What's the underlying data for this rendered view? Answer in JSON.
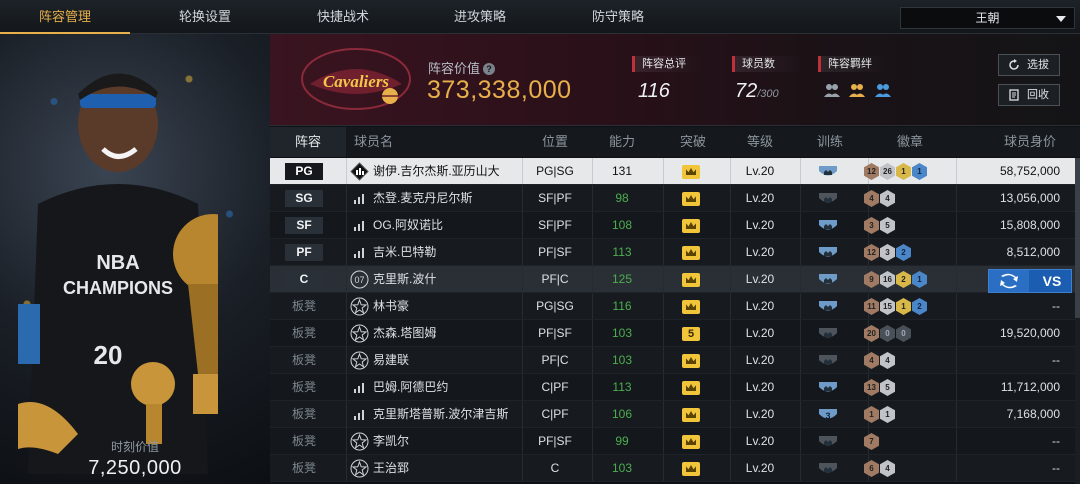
{
  "nav": {
    "tabs": [
      {
        "label": "阵容管理",
        "active": true
      },
      {
        "label": "轮换设置",
        "active": false
      },
      {
        "label": "快捷战术",
        "active": false
      },
      {
        "label": "进攻策略",
        "active": false
      },
      {
        "label": "防守策略",
        "active": false
      }
    ],
    "team_selected": "王朝"
  },
  "left_panel": {
    "player_value_label": "时刻价值",
    "player_value": "7,250,000"
  },
  "header": {
    "lineup_value_label": "阵容价值",
    "lineup_value": "373,338,000",
    "overall_label": "阵容总评",
    "overall_value": "116",
    "player_count_label": "球员数",
    "player_count_value": "72",
    "player_count_max": "/300",
    "bonds_label": "阵容羁绊",
    "filter_button": "选拔",
    "recycle_button": "回收"
  },
  "table": {
    "columns": [
      "阵容",
      "球员名",
      "位置",
      "能力",
      "突破",
      "等级",
      "训练",
      "徽章",
      "球员身价"
    ],
    "rows": [
      {
        "slot": "PG",
        "bench": false,
        "name": "谢伊.吉尔杰斯.亚历山大",
        "icon": "diamond-card-icon",
        "position": "PG|SG",
        "ability": "131",
        "breakthrough": "crown",
        "level": "Lv.20",
        "training": "blue",
        "badges": [
          [
            "bronze",
            "12"
          ],
          [
            "silver",
            "26"
          ],
          [
            "gold",
            "1"
          ],
          [
            "blue",
            "1"
          ]
        ],
        "salary": "58,752,000",
        "selected": true
      },
      {
        "slot": "SG",
        "bench": false,
        "name": "杰登.麦克丹尼尔斯",
        "icon": "signal-icon",
        "position": "SF|PF",
        "ability": "98",
        "breakthrough": "crown",
        "level": "Lv.20",
        "training": "grey",
        "badges": [
          [
            "bronze",
            "4"
          ],
          [
            "silver",
            "4"
          ]
        ],
        "salary": "13,056,000"
      },
      {
        "slot": "SF",
        "bench": false,
        "name": "OG.阿奴诺比",
        "icon": "signal-icon",
        "position": "SF|PF",
        "ability": "108",
        "breakthrough": "crown",
        "level": "Lv.20",
        "training": "blue",
        "badges": [
          [
            "bronze",
            "3"
          ],
          [
            "silver",
            "5"
          ]
        ],
        "salary": "15,808,000"
      },
      {
        "slot": "PF",
        "bench": false,
        "name": "吉米.巴特勒",
        "icon": "signal-icon",
        "position": "PF|SF",
        "ability": "113",
        "breakthrough": "crown",
        "level": "Lv.20",
        "training": "blue",
        "badges": [
          [
            "bronze",
            "12"
          ],
          [
            "silver",
            "3"
          ],
          [
            "blue",
            "2"
          ]
        ],
        "salary": "8,512,000"
      },
      {
        "slot": "C",
        "bench": false,
        "name": "克里斯.波什",
        "icon": "number-07-icon",
        "icon_text": "07",
        "position": "PF|C",
        "ability": "125",
        "breakthrough": "crown",
        "level": "Lv.20",
        "training": "blue",
        "badges": [
          [
            "bronze",
            "9"
          ],
          [
            "silver",
            "16"
          ],
          [
            "gold",
            "2"
          ],
          [
            "blue",
            "1"
          ]
        ],
        "salary": "",
        "hover": true
      },
      {
        "slot": "板凳",
        "bench": true,
        "name": "林书豪",
        "icon": "star-icon",
        "position": "PG|SG",
        "ability": "116",
        "breakthrough": "crown",
        "level": "Lv.20",
        "training": "blue",
        "badges": [
          [
            "bronze",
            "11"
          ],
          [
            "silver",
            "15"
          ],
          [
            "gold",
            "1"
          ],
          [
            "blue",
            "2"
          ]
        ],
        "salary": "--"
      },
      {
        "slot": "板凳",
        "bench": true,
        "name": "杰森.塔图姆",
        "icon": "star-icon",
        "position": "PF|SF",
        "ability": "103",
        "breakthrough": "5",
        "level": "Lv.20",
        "training": "grey",
        "badges": [
          [
            "bronze",
            "20"
          ],
          [
            "dark",
            "0"
          ],
          [
            "dark",
            "0"
          ]
        ],
        "salary": "19,520,000"
      },
      {
        "slot": "板凳",
        "bench": true,
        "name": "易建联",
        "icon": "star-icon",
        "position": "PF|C",
        "ability": "103",
        "breakthrough": "crown",
        "level": "Lv.20",
        "training": "grey",
        "badges": [
          [
            "bronze",
            "4"
          ],
          [
            "silver",
            "4"
          ]
        ],
        "salary": "--"
      },
      {
        "slot": "板凳",
        "bench": true,
        "name": "巴姆.阿德巴约",
        "icon": "signal-icon",
        "position": "C|PF",
        "ability": "113",
        "breakthrough": "crown",
        "level": "Lv.20",
        "training": "blue",
        "badges": [
          [
            "bronze",
            "13"
          ],
          [
            "silver",
            "5"
          ]
        ],
        "salary": "11,712,000"
      },
      {
        "slot": "板凳",
        "bench": true,
        "name": "克里斯塔普斯.波尔津吉斯",
        "icon": "signal-icon",
        "position": "C|PF",
        "ability": "106",
        "breakthrough": "crown",
        "level": "Lv.20",
        "training": "blue3",
        "badges": [
          [
            "bronze",
            "1"
          ],
          [
            "silver",
            "1"
          ]
        ],
        "salary": "7,168,000"
      },
      {
        "slot": "板凳",
        "bench": true,
        "name": "李凯尔",
        "icon": "star-icon",
        "position": "PF|SF",
        "ability": "99",
        "breakthrough": "crown",
        "level": "Lv.20",
        "training": "grey",
        "badges": [
          [
            "bronze",
            "7"
          ]
        ],
        "salary": "--"
      },
      {
        "slot": "板凳",
        "bench": true,
        "name": "王治郅",
        "icon": "star-icon",
        "position": "C",
        "ability": "103",
        "breakthrough": "crown",
        "level": "Lv.20",
        "training": "grey",
        "badges": [
          [
            "bronze",
            "6"
          ],
          [
            "silver",
            "4"
          ]
        ],
        "salary": "--"
      }
    ],
    "vs_button": "VS"
  },
  "colors": {
    "accent_gold": "#e8b04a",
    "ability_green": "#4cae4f",
    "stat_red": "#c0303a",
    "vs_blue": "#1b5db0"
  }
}
